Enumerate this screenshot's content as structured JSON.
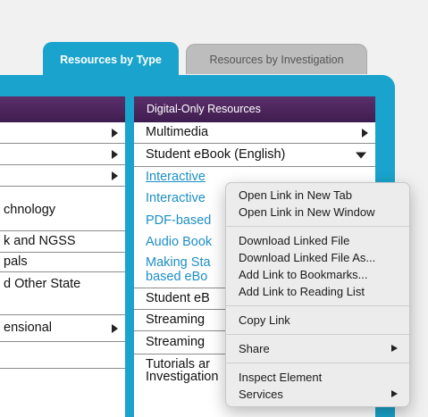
{
  "tabs": {
    "active": "Resources by Type",
    "inactive": "Resources by Investigation"
  },
  "left_column": {
    "rows": [
      {
        "label": "",
        "arrow": true
      },
      {
        "label": "",
        "arrow": true
      },
      {
        "label": "",
        "arrow": true
      },
      {
        "label": "chnology",
        "arrow": false
      },
      {
        "label": "k and NGSS",
        "arrow": false
      },
      {
        "label": "pals",
        "arrow": false
      },
      {
        "label": "d Other State",
        "arrow": false
      },
      {
        "label": "ensional",
        "arrow": true
      },
      {
        "label": "",
        "arrow": false
      }
    ]
  },
  "right_column": {
    "header": "Digital-Only Resources",
    "rows": {
      "multimedia": "Multimedia",
      "student_ebook": "Student eBook (English)",
      "interactive1": "Interactive",
      "interactive2": "Interactive",
      "pdf_based": "PDF-based",
      "audio_book": "Audio Book",
      "making_sta_1": "Making Sta",
      "making_sta_2": "based eBo",
      "student_eb": "Student eB",
      "streaming1": "Streaming",
      "streaming2": "Streaming",
      "tutorials": "Tutorials ar",
      "investigations": "Investigation"
    }
  },
  "context_menu": {
    "open_new_tab": "Open Link in New Tab",
    "open_new_window": "Open Link in New Window",
    "download_linked_file": "Download Linked File",
    "download_linked_file_as": "Download Linked File As...",
    "add_to_bookmarks": "Add Link to Bookmarks...",
    "add_to_reading_list": "Add Link to Reading List",
    "copy_link": "Copy Link",
    "share": "Share",
    "inspect_element": "Inspect Element",
    "services": "Services"
  },
  "colors": {
    "tab_active": "#1aa3cc",
    "header_purple": "#4a245a",
    "link_blue": "#1d8fc4"
  }
}
